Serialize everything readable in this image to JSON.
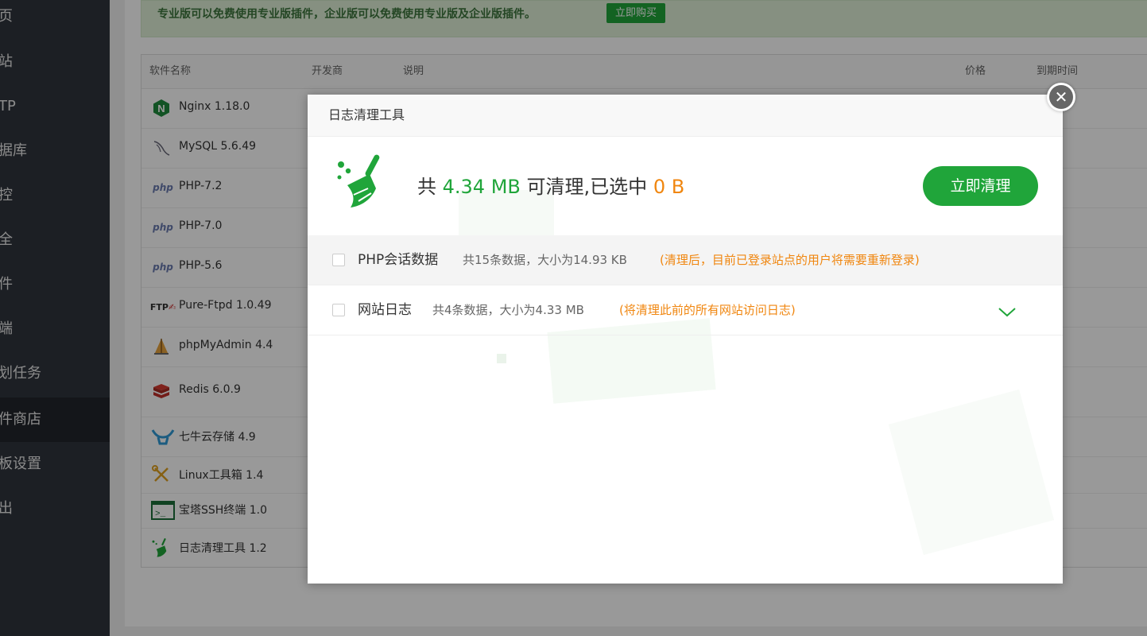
{
  "sidebar": {
    "items": [
      {
        "label": "首页"
      },
      {
        "label": "网站"
      },
      {
        "label": "FTP"
      },
      {
        "label": "数据库"
      },
      {
        "label": "监控"
      },
      {
        "label": "安全"
      },
      {
        "label": "文件"
      },
      {
        "label": "终端"
      },
      {
        "label": "计划任务"
      },
      {
        "label": "软件商店"
      },
      {
        "label": "面板设置"
      },
      {
        "label": "退出"
      }
    ]
  },
  "banner": {
    "text": "专业版可以免费使用专业版插件，企业版可以免费使用专业版及企业版插件。",
    "buy_label": "立即购买"
  },
  "table": {
    "headers": [
      "软件名称",
      "开发商",
      "说明",
      "价格",
      "到期时间"
    ],
    "rows": [
      {
        "name": "Nginx 1.18.0",
        "icon": "nginx-icon"
      },
      {
        "name": "MySQL 5.6.49",
        "icon": "mysql-icon"
      },
      {
        "name": "PHP-7.2",
        "icon": "php-icon"
      },
      {
        "name": "PHP-7.0",
        "icon": "php-icon"
      },
      {
        "name": "PHP-5.6",
        "icon": "php-icon"
      },
      {
        "name": "Pure-Ftpd 1.0.49",
        "icon": "ftp-icon"
      },
      {
        "name": "phpMyAdmin 4.4",
        "icon": "phpmyadmin-icon"
      },
      {
        "name": "Redis 6.0.9",
        "icon": "redis-icon"
      },
      {
        "name": "七牛云存储 4.9",
        "icon": "qiniu-icon"
      },
      {
        "name": "Linux工具箱 1.4",
        "icon": "tools-icon"
      },
      {
        "name": "宝塔SSH终端 1.0",
        "icon": "terminal-icon"
      },
      {
        "name": "日志清理工具 1.2",
        "icon": "broom-icon"
      }
    ],
    "php_badge": "php",
    "ftp_badge": "FTP"
  },
  "modal": {
    "title": "日志清理工具",
    "summary": {
      "prefix": "共",
      "total": "4.34 MB",
      "middle": "可清理,已选中",
      "selected": "0 B"
    },
    "clean_label": "立即清理",
    "items": [
      {
        "name": "PHP会话数据",
        "info": "共15条数据，大小为14.93 KB",
        "note": "(清理后，目前已登录站点的用户将需要重新登录)",
        "checked": false
      },
      {
        "name": "网站日志",
        "info": "共4条数据，大小为4.33 MB",
        "note": "(将清理此前的所有网站访问日志)",
        "checked": false
      }
    ],
    "close_glyph": "✕"
  },
  "colors": {
    "accent": "#20a53a",
    "warning": "#f0860f",
    "sidebar": "#2f343c"
  }
}
